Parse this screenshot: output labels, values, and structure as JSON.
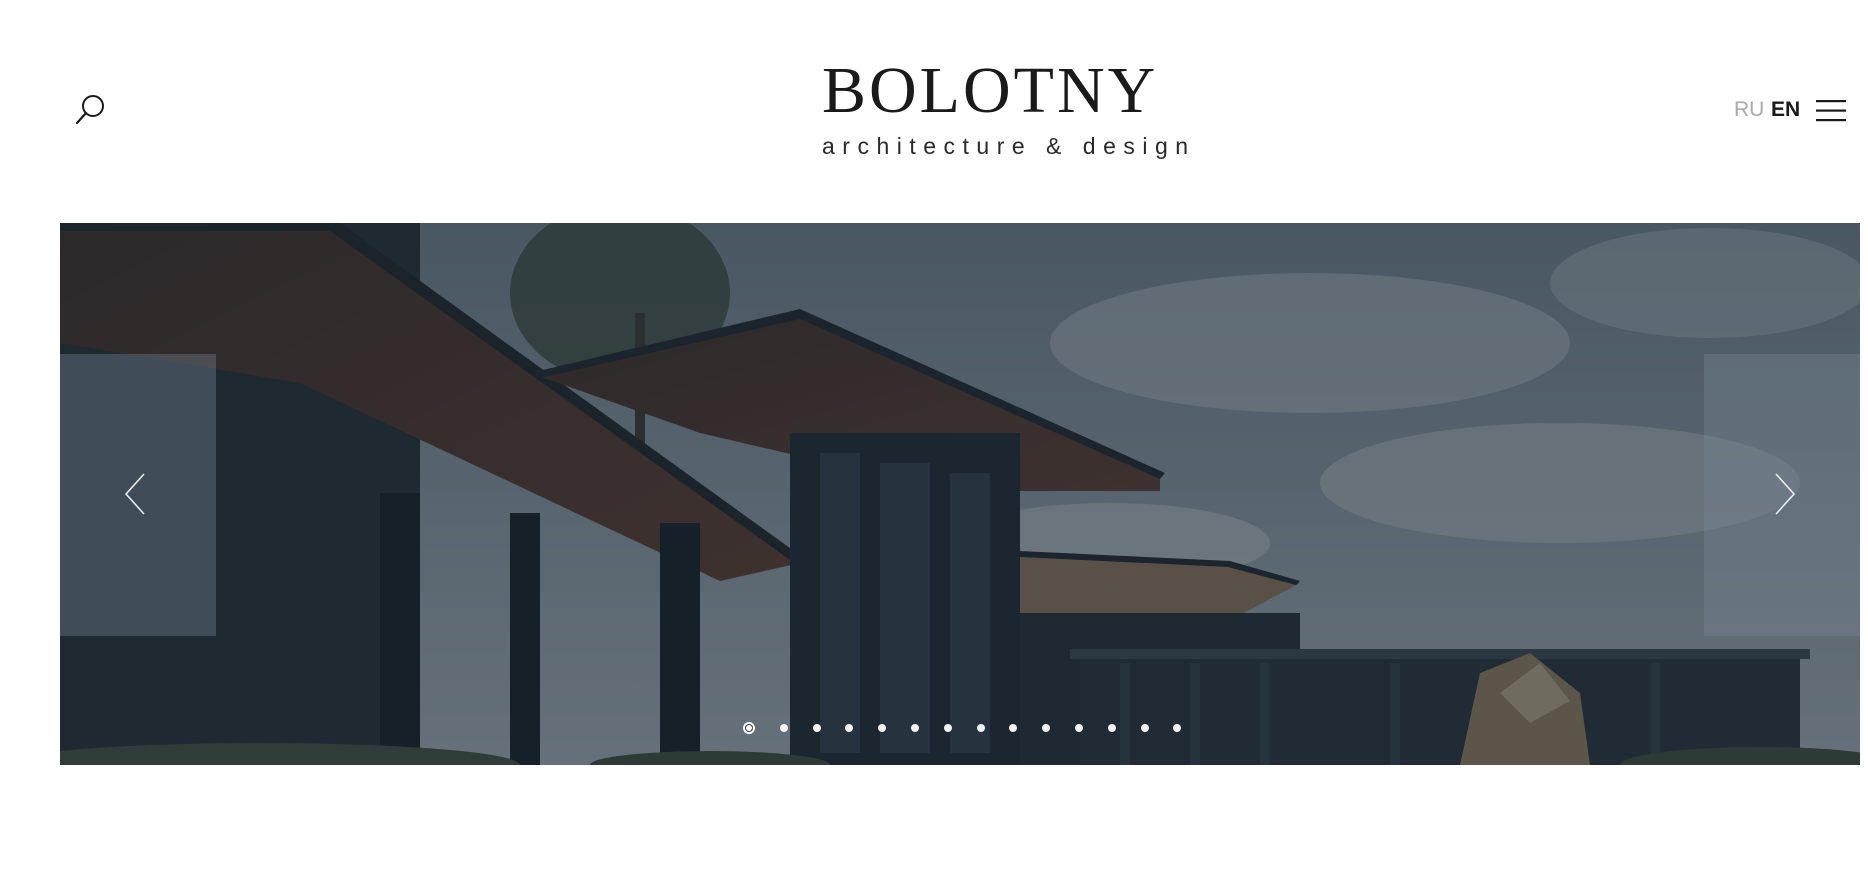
{
  "header": {
    "logo_title": "BOLOTNY",
    "logo_subtitle": "architecture & design",
    "icons": {
      "search": "search-icon",
      "menu": "hamburger-menu-icon"
    },
    "languages": [
      {
        "label": "RU",
        "active": false
      },
      {
        "label": "EN",
        "active": true
      }
    ]
  },
  "slider": {
    "slide_count": 14,
    "active_slide": 1,
    "icons": {
      "prev": "chevron-left-icon",
      "next": "chevron-right-icon"
    },
    "colors": {
      "overlay": "#2b3640",
      "roof_underside": "#4a3228",
      "sky": "#8fa0ad"
    }
  }
}
